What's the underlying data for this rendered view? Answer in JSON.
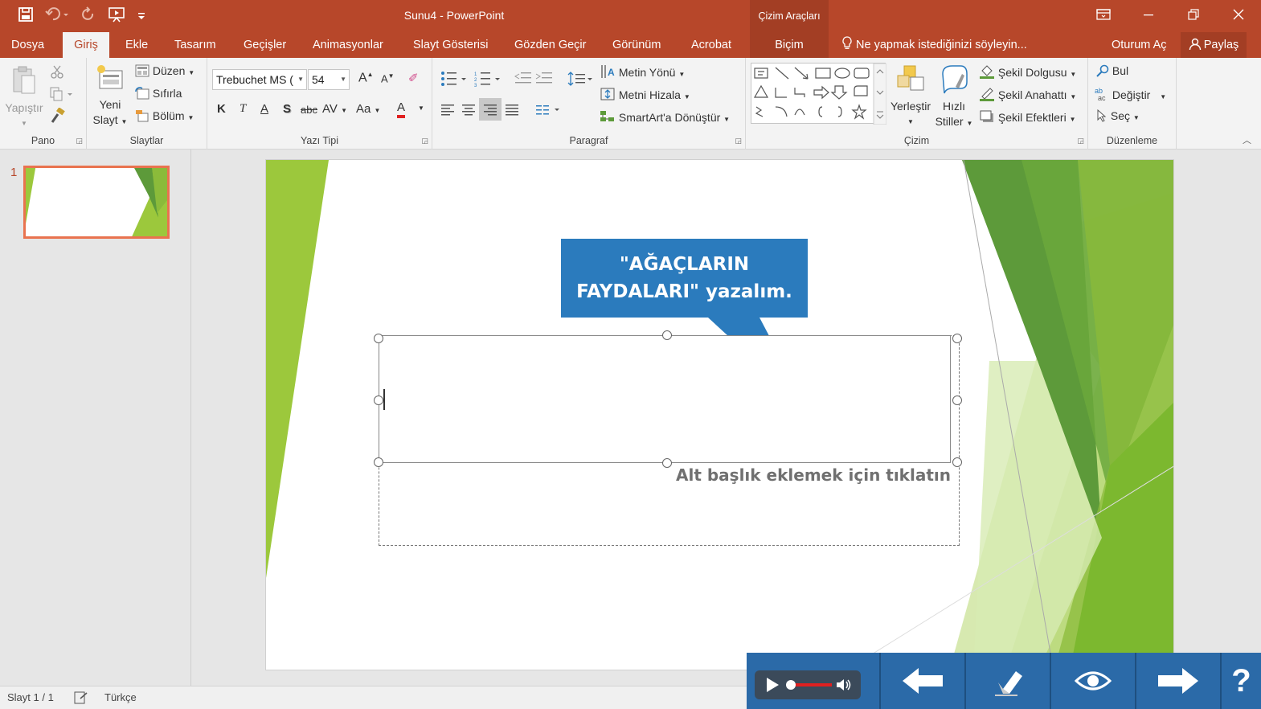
{
  "window": {
    "title": "Sunu4 - PowerPoint",
    "context_tools_label": "Çizim Araçları"
  },
  "qat": {
    "save_icon": "save-icon",
    "undo_icon": "undo-icon",
    "redo_icon": "redo-icon",
    "present_icon": "present-icon",
    "customize_icon": "customize-icon"
  },
  "tabs": [
    {
      "label": "Dosya"
    },
    {
      "label": "Giriş"
    },
    {
      "label": "Ekle"
    },
    {
      "label": "Tasarım"
    },
    {
      "label": "Geçişler"
    },
    {
      "label": "Animasyonlar"
    },
    {
      "label": "Slayt Gösterisi"
    },
    {
      "label": "Gözden Geçir"
    },
    {
      "label": "Görünüm"
    },
    {
      "label": "Acrobat"
    },
    {
      "label": "Biçim"
    }
  ],
  "tell_me": "Ne yapmak istediğinizi söyleyin...",
  "sign_in": "Oturum Aç",
  "share": "Paylaş",
  "ribbon": {
    "pano": {
      "label": "Pano",
      "paste": "Yapıştır"
    },
    "slaytlar": {
      "label": "Slaytlar",
      "new_slide_1": "Yeni",
      "new_slide_2": "Slayt",
      "layout": "Düzen",
      "reset": "Sıfırla",
      "section": "Bölüm"
    },
    "yazi_tipi": {
      "label": "Yazı Tipi",
      "font": "Trebuchet MS (",
      "size": "54",
      "bold": "K",
      "italic": "T",
      "underline": "A",
      "shadow": "S",
      "strike": "abc",
      "spacing": "AV",
      "case": "Aa",
      "color": "A"
    },
    "paragraf": {
      "label": "Paragraf",
      "text_direction": "Metin Yönü",
      "align_text": "Metni Hizala",
      "smartart": "SmartArt'a Dönüştür"
    },
    "cizim": {
      "label": "Çizim",
      "arrange": "Yerleştir",
      "quick_styles_1": "Hızlı",
      "quick_styles_2": "Stiller",
      "fill": "Şekil Dolgusu",
      "outline": "Şekil Anahattı",
      "effects": "Şekil Efektleri"
    },
    "duzenleme": {
      "label": "Düzenleme",
      "find": "Bul",
      "replace": "Değiştir",
      "select": "Seç"
    }
  },
  "thumbnails": [
    {
      "number": "1"
    }
  ],
  "slide": {
    "callout": "\"AĞAÇLARIN FAYDALARI\" yazalım.",
    "subtitle_placeholder": "Alt başlık eklemek için tıklatın",
    "colors": {
      "callout": "#2b7bbd",
      "green_dark": "#5d9a3a",
      "green_light": "#9cc83c"
    }
  },
  "status": {
    "slide": "Slayt 1 / 1",
    "language": "Türkçe"
  },
  "overlay": {
    "help": "?"
  }
}
